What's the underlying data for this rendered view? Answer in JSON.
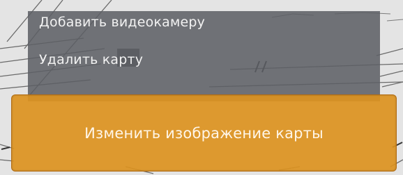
{
  "context_menu": {
    "items": [
      {
        "label": "Добавить видеокамеру"
      },
      {
        "label": "Удалить карту"
      }
    ],
    "primary_action": {
      "label": "Изменить изображение карты"
    }
  },
  "colors": {
    "menu_background": "#5c5e64",
    "primary_button": "#dc9220",
    "text": "#f2f2f2"
  }
}
